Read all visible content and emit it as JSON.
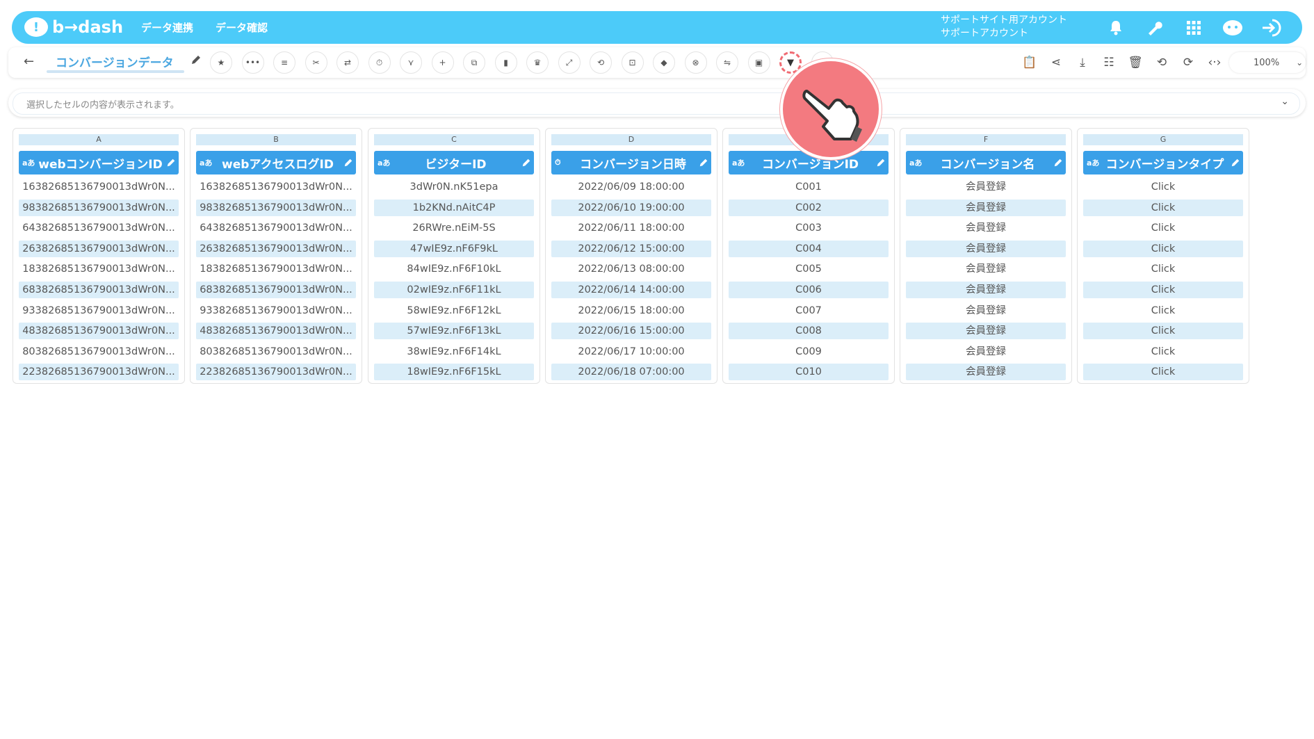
{
  "app": {
    "logo_text": "b→dash"
  },
  "topnav": {
    "items": [
      "データ連携",
      "データ確認"
    ]
  },
  "account": {
    "line1": "サポートサイト用アカウント",
    "line2": "サポートアカウント"
  },
  "topicons": [
    "bell-icon",
    "wrench-icon",
    "grid-icon",
    "mascot-icon",
    "logout-icon"
  ],
  "toolbar": {
    "back_icon": "←",
    "sheet_title": "コンバージョンデータ",
    "tools": [
      "star-icon",
      "more-icon",
      "text-icon",
      "cut-icon",
      "swap-icon",
      "timer-icon",
      "merge-icon",
      "add-icon",
      "copy-icon",
      "delete-icon",
      "crown-icon",
      "expand-icon",
      "repeat-icon",
      "lock-icon",
      "box-icon",
      "cancel-icon",
      "translate-icon",
      "frame-icon",
      "filter-icon",
      "split-icon"
    ],
    "right_icons": [
      "clipboard-icon",
      "share-icon",
      "download-icon",
      "list-icon",
      "trash-icon",
      "history-icon",
      "refresh-icon",
      "code-icon"
    ],
    "zoom": "100%"
  },
  "cellbar": {
    "placeholder": "選択したセルの内容が表示されます。"
  },
  "columns": [
    {
      "letter": "A",
      "type": "aあ",
      "name": "webコンバージョンID",
      "cells": [
        "16382685136790013dWr0N...",
        "98382685136790013dWr0N...",
        "64382685136790013dWr0N...",
        "26382685136790013dWr0N...",
        "18382685136790013dWr0N...",
        "68382685136790013dWr0N...",
        "93382685136790013dWr0N...",
        "48382685136790013dWr0N...",
        "80382685136790013dWr0N...",
        "22382685136790013dWr0N..."
      ]
    },
    {
      "letter": "B",
      "type": "aあ",
      "name": "webアクセスログID",
      "cells": [
        "16382685136790013dWr0N...",
        "98382685136790013dWr0N...",
        "64382685136790013dWr0N...",
        "26382685136790013dWr0N...",
        "18382685136790013dWr0N...",
        "68382685136790013dWr0N...",
        "93382685136790013dWr0N...",
        "48382685136790013dWr0N...",
        "80382685136790013dWr0N...",
        "22382685136790013dWr0N..."
      ]
    },
    {
      "letter": "C",
      "type": "aあ",
      "name": "ビジターID",
      "cells": [
        "3dWr0N.nK51epa",
        "1b2KNd.nAitC4P",
        "26RWre.nEiM-5S",
        "47wIE9z.nF6F9kL",
        "84wIE9z.nF6F10kL",
        "02wIE9z.nF6F11kL",
        "58wIE9z.nF6F12kL",
        "57wIE9z.nF6F13kL",
        "38wIE9z.nF6F14kL",
        "18wIE9z.nF6F15kL"
      ]
    },
    {
      "letter": "D",
      "type": "⏱",
      "name": "コンバージョン日時",
      "cells": [
        "2022/06/09 18:00:00",
        "2022/06/10 19:00:00",
        "2022/06/11 18:00:00",
        "2022/06/12 15:00:00",
        "2022/06/13 08:00:00",
        "2022/06/14 14:00:00",
        "2022/06/15 18:00:00",
        "2022/06/16 15:00:00",
        "2022/06/17 10:00:00",
        "2022/06/18 07:00:00"
      ]
    },
    {
      "letter": "",
      "type": "aあ",
      "name": "コンバージョンID",
      "cells": [
        "C001",
        "C002",
        "C003",
        "C004",
        "C005",
        "C006",
        "C007",
        "C008",
        "C009",
        "C010"
      ]
    },
    {
      "letter": "F",
      "type": "aあ",
      "name": "コンバージョン名",
      "cells": [
        "会員登録",
        "会員登録",
        "会員登録",
        "会員登録",
        "会員登録",
        "会員登録",
        "会員登録",
        "会員登録",
        "会員登録",
        "会員登録"
      ]
    },
    {
      "letter": "G",
      "type": "aあ",
      "name": "コンバージョンタイプ",
      "cells": [
        "Click",
        "Click",
        "Click",
        "Click",
        "Click",
        "Click",
        "Click",
        "Click",
        "Click",
        "Click"
      ]
    }
  ]
}
